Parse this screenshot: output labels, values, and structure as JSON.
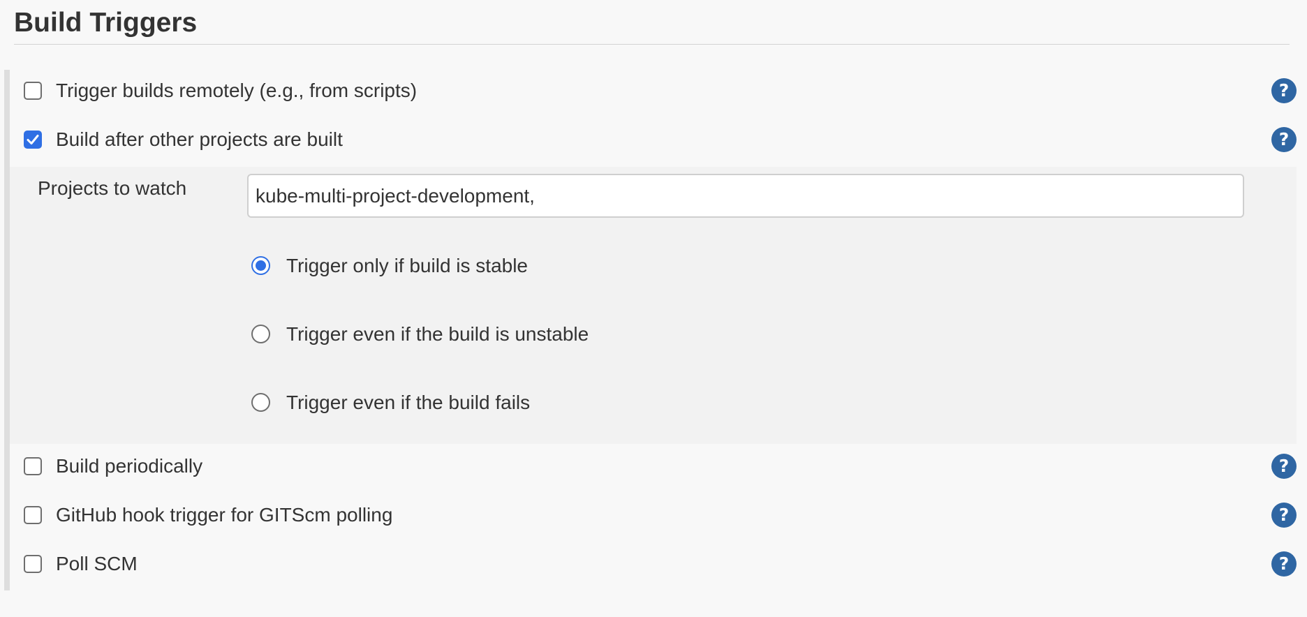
{
  "section": {
    "title": "Build Triggers"
  },
  "triggers": [
    {
      "label": "Trigger builds remotely (e.g., from scripts)",
      "checked": false,
      "help": "?"
    },
    {
      "label": "Build after other projects are built",
      "checked": true,
      "help": "?"
    },
    {
      "label": "Build periodically",
      "checked": false,
      "help": "?"
    },
    {
      "label": "GitHub hook trigger for GITScm polling",
      "checked": false,
      "help": "?"
    },
    {
      "label": "Poll SCM",
      "checked": false,
      "help": "?"
    }
  ],
  "build_after": {
    "projects_label": "Projects to watch",
    "projects_value": "kube-multi-project-development,",
    "options": [
      {
        "label": "Trigger only if build is stable",
        "selected": true
      },
      {
        "label": "Trigger even if the build is unstable",
        "selected": false
      },
      {
        "label": "Trigger even if the build fails",
        "selected": false
      }
    ]
  },
  "colors": {
    "accent": "#2f6fe4",
    "help_icon": "#2f66a3",
    "nested_background": "#f2f2f2",
    "page_background": "#f8f8f8"
  },
  "icons": {
    "help": "help-icon",
    "check": "checkmark-icon"
  }
}
